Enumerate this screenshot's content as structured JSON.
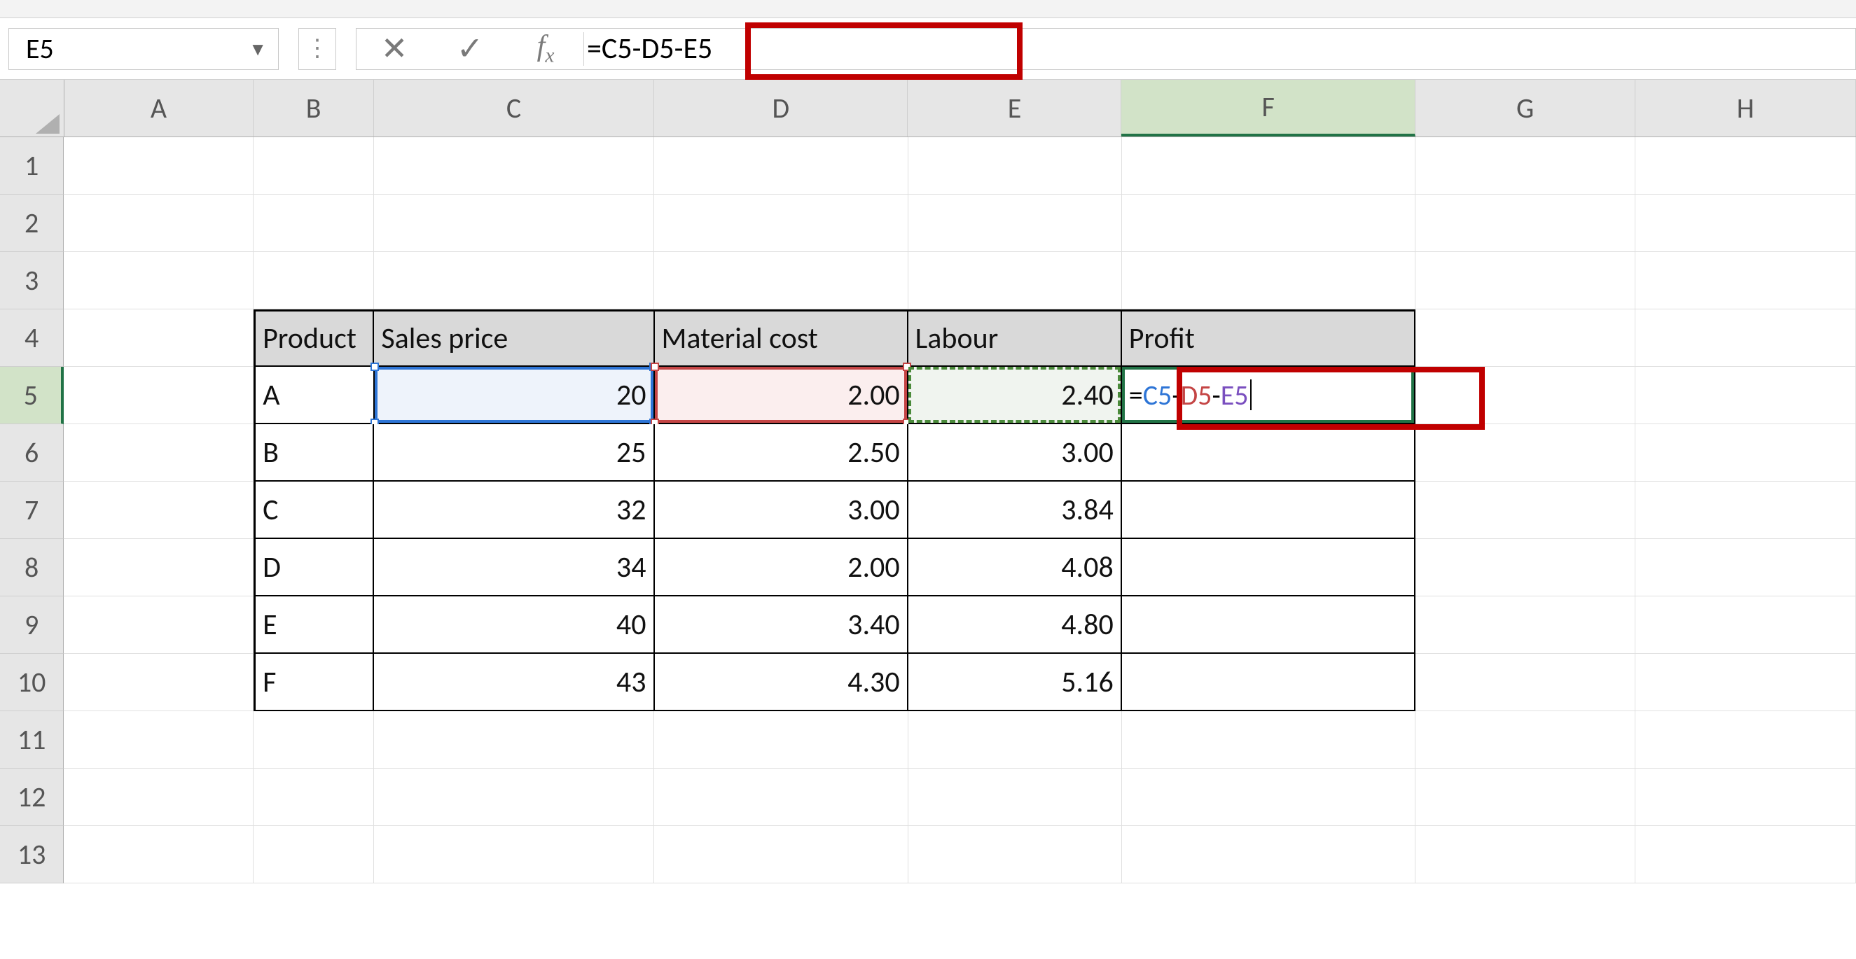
{
  "name_box": "E5",
  "formula_bar": "=C5-D5-E5",
  "columns": [
    "A",
    "B",
    "C",
    "D",
    "E",
    "F",
    "G",
    "H"
  ],
  "row_labels": [
    "1",
    "2",
    "3",
    "4",
    "5",
    "6",
    "7",
    "8",
    "9",
    "10",
    "11",
    "12",
    "13"
  ],
  "active_column": "F",
  "active_row": "5",
  "table": {
    "headers": {
      "B": "Product",
      "C": "Sales price",
      "D": "Material cost",
      "E": "Labour",
      "F": "Profit"
    },
    "rows": [
      {
        "B": "A",
        "C": "20",
        "D": "2.00",
        "E": "2.40"
      },
      {
        "B": "B",
        "C": "25",
        "D": "2.50",
        "E": "3.00"
      },
      {
        "B": "C",
        "C": "32",
        "D": "3.00",
        "E": "3.84"
      },
      {
        "B": "D",
        "C": "34",
        "D": "2.00",
        "E": "4.08"
      },
      {
        "B": "E",
        "C": "40",
        "D": "3.40",
        "E": "4.80"
      },
      {
        "B": "F",
        "C": "43",
        "D": "4.30",
        "E": "5.16"
      }
    ]
  },
  "edit_formula_tokens": {
    "eq": "=",
    "c5": "C5",
    "m1": "-",
    "d5": "D5",
    "m2": "-",
    "e5": "E5"
  },
  "chart_data": {
    "type": "table",
    "title": "",
    "columns": [
      "Product",
      "Sales price",
      "Material cost",
      "Labour",
      "Profit"
    ],
    "rows": [
      [
        "A",
        20,
        2.0,
        2.4,
        null
      ],
      [
        "B",
        25,
        2.5,
        3.0,
        null
      ],
      [
        "C",
        32,
        3.0,
        3.84,
        null
      ],
      [
        "D",
        34,
        2.0,
        4.08,
        null
      ],
      [
        "E",
        40,
        3.4,
        4.8,
        null
      ],
      [
        "F",
        43,
        4.3,
        5.16,
        null
      ]
    ],
    "note": "Profit formula being entered in F5: =C5-D5-E5"
  }
}
